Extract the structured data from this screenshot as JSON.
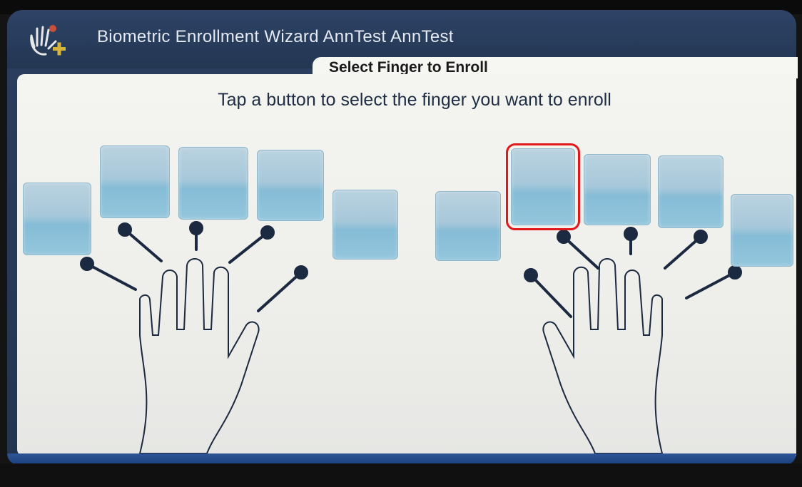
{
  "window": {
    "title": "Biometric Enrollment Wizard  AnnTest AnnTest",
    "tab": "Select Finger to Enroll"
  },
  "instruction": "Tap a button to select the finger you want to enroll",
  "fingers": {
    "left": [
      "left-little",
      "left-ring",
      "left-middle",
      "left-index",
      "left-thumb"
    ],
    "right": [
      "right-thumb",
      "right-index",
      "right-middle",
      "right-ring",
      "right-little"
    ],
    "selected": "right-index"
  },
  "colors": {
    "titlebar": "#2e4366",
    "button": "#a7c8da",
    "selection": "#e0181c",
    "hand_lines": "#1b2a40"
  },
  "icons": {
    "app_logo": "hand-with-plus-icon"
  }
}
